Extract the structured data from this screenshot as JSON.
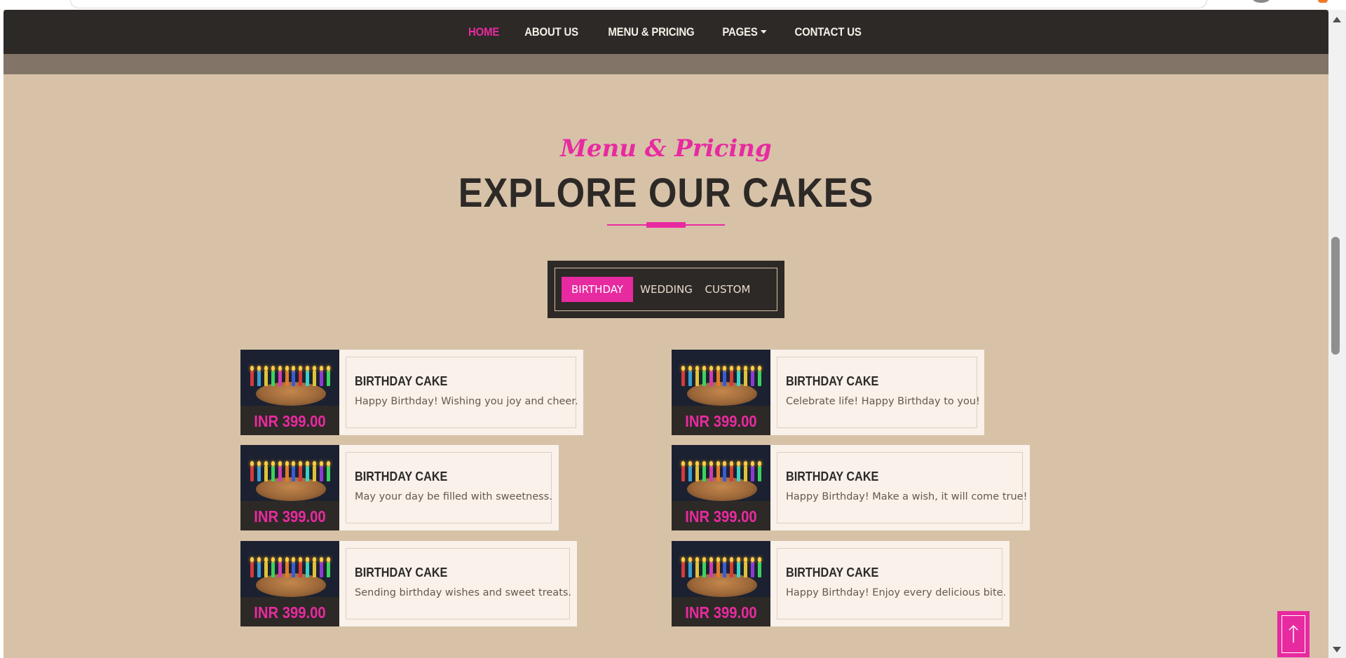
{
  "nav": {
    "items": [
      {
        "label": "HOME",
        "active": true
      },
      {
        "label": "ABOUT US",
        "active": false
      },
      {
        "label": "MENU & PRICING",
        "active": false
      },
      {
        "label": "PAGES",
        "active": false,
        "dropdown": true
      },
      {
        "label": "CONTACT US",
        "active": false
      }
    ]
  },
  "section": {
    "subtitle": "Menu & Pricing",
    "title": "EXPLORE OUR CAKES"
  },
  "tabs": [
    {
      "label": "BIRTHDAY",
      "active": true
    },
    {
      "label": "WEDDING",
      "active": false
    },
    {
      "label": "CUSTOM",
      "active": false
    }
  ],
  "cards": [
    {
      "title": "BIRTHDAY CAKE",
      "desc": "Happy Birthday! Wishing you joy and cheer.",
      "price": "INR 399.00"
    },
    {
      "title": "BIRTHDAY CAKE",
      "desc": "Celebrate life! Happy Birthday to you!",
      "price": "INR 399.00"
    },
    {
      "title": "BIRTHDAY CAKE",
      "desc": "May your day be filled with sweetness.",
      "price": "INR 399.00"
    },
    {
      "title": "BIRTHDAY CAKE",
      "desc": "Happy Birthday! Make a wish, it will come true!",
      "price": "INR 399.00"
    },
    {
      "title": "BIRTHDAY CAKE",
      "desc": "Sending birthday wishes and sweet treats.",
      "price": "INR 399.00"
    },
    {
      "title": "BIRTHDAY CAKE",
      "desc": "Happy Birthday! Enjoy every delicious bite.",
      "price": "INR 399.00"
    }
  ],
  "colors": {
    "accent": "#e82aa0",
    "dark": "#2d2926",
    "background": "#d7c2a8",
    "card": "#f9f1ea"
  },
  "icons": {
    "scroll_top": "arrow-up-icon",
    "dropdown": "caret-down-icon"
  }
}
